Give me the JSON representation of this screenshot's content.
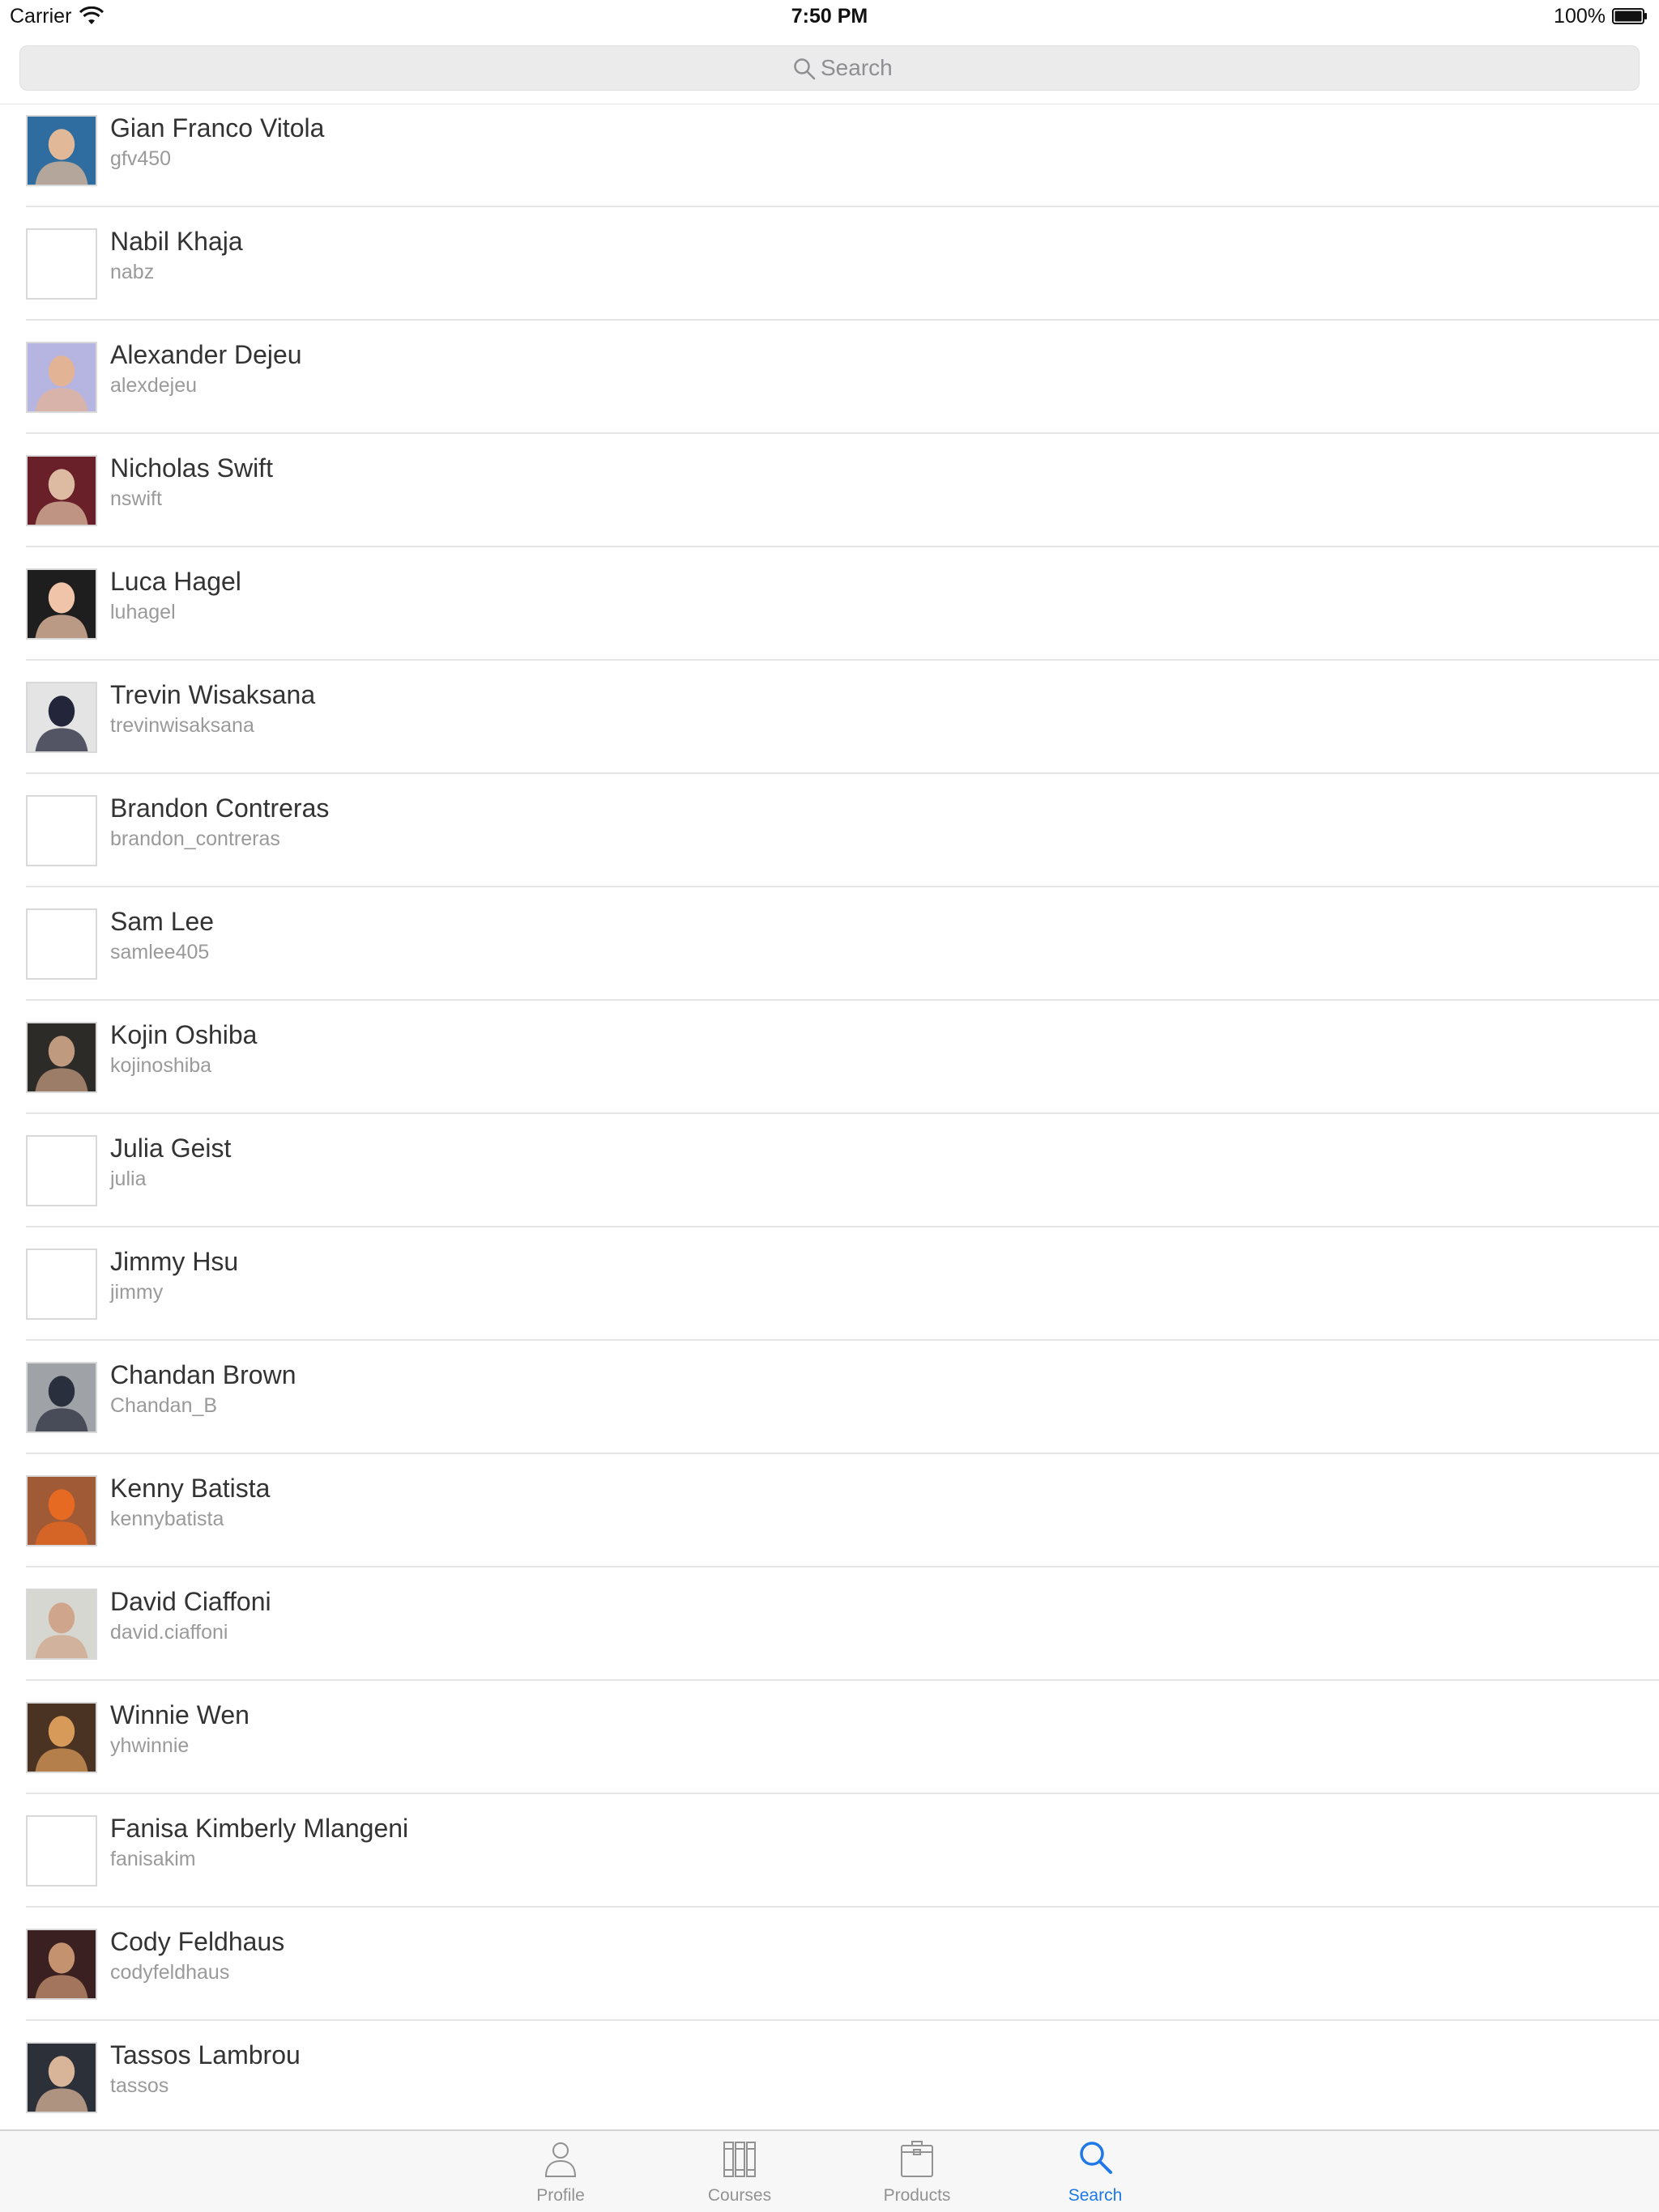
{
  "status_bar": {
    "carrier": "Carrier",
    "time": "7:50 PM",
    "battery": "100%"
  },
  "search": {
    "placeholder": "Search"
  },
  "users": [
    {
      "name": "Gian Franco Vitola",
      "username": "gfv450",
      "has_photo": true,
      "photo_colors": [
        "#2f6da0",
        "#e2b998"
      ]
    },
    {
      "name": "Nabil Khaja",
      "username": "nabz",
      "has_photo": false
    },
    {
      "name": "Alexander Dejeu",
      "username": "alexdejeu",
      "has_photo": true,
      "photo_colors": [
        "#b6b5e2",
        "#e3b396"
      ]
    },
    {
      "name": "Nicholas Swift",
      "username": "nswift",
      "has_photo": true,
      "photo_colors": [
        "#6a2028",
        "#ddbba2"
      ]
    },
    {
      "name": "Luca Hagel",
      "username": "luhagel",
      "has_photo": true,
      "photo_colors": [
        "#1e1e1e",
        "#f0c4a8"
      ]
    },
    {
      "name": "Trevin Wisaksana",
      "username": "trevinwisaksana",
      "has_photo": true,
      "photo_colors": [
        "#e4e4e4",
        "#23253a"
      ]
    },
    {
      "name": "Brandon Contreras",
      "username": "brandon_contreras",
      "has_photo": false
    },
    {
      "name": "Sam Lee",
      "username": "samlee405",
      "has_photo": false
    },
    {
      "name": "Kojin Oshiba",
      "username": "kojinoshiba",
      "has_photo": true,
      "photo_colors": [
        "#2d2b28",
        "#c09a7e"
      ]
    },
    {
      "name": "Julia Geist",
      "username": "julia",
      "has_photo": false
    },
    {
      "name": "Jimmy Hsu",
      "username": "jimmy",
      "has_photo": false
    },
    {
      "name": "Chandan Brown",
      "username": "Chandan_B",
      "has_photo": true,
      "photo_colors": [
        "#9fa3a8",
        "#2a2f3d"
      ]
    },
    {
      "name": "Kenny Batista",
      "username": "kennybatista",
      "has_photo": true,
      "photo_colors": [
        "#a05a36",
        "#e66a22"
      ]
    },
    {
      "name": "David Ciaffoni",
      "username": "david.ciaffoni",
      "has_photo": true,
      "photo_colors": [
        "#d7d7d2",
        "#cfa58b"
      ]
    },
    {
      "name": "Winnie Wen",
      "username": "yhwinnie",
      "has_photo": true,
      "photo_colors": [
        "#4a3322",
        "#d89a58"
      ]
    },
    {
      "name": "Fanisa Kimberly Mlangeni",
      "username": "fanisakim",
      "has_photo": false
    },
    {
      "name": "Cody Feldhaus",
      "username": "codyfeldhaus",
      "has_photo": true,
      "photo_colors": [
        "#3a2020",
        "#c59270"
      ]
    },
    {
      "name": "Tassos Lambrou",
      "username": "tassos",
      "has_photo": true,
      "photo_colors": [
        "#2c3038",
        "#d8b498"
      ]
    }
  ],
  "tabs": [
    {
      "label": "Profile",
      "icon": "profile-icon",
      "active": false
    },
    {
      "label": "Courses",
      "icon": "courses-icon",
      "active": false
    },
    {
      "label": "Products",
      "icon": "products-icon",
      "active": false
    },
    {
      "label": "Search",
      "icon": "search-icon",
      "active": true
    }
  ],
  "colors": {
    "accent": "#1f78e8",
    "inactive_tab": "#929292",
    "separator": "#e6e6e6"
  }
}
